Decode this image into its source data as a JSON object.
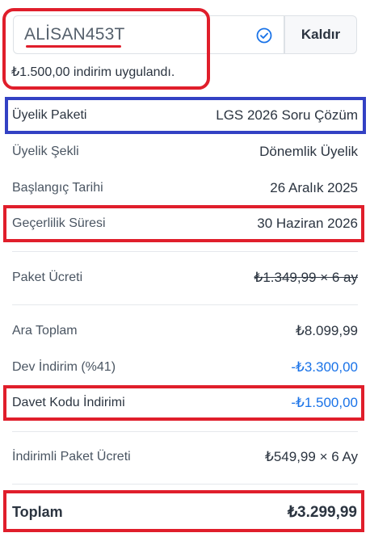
{
  "coupon": {
    "code": "ALİSAN453T",
    "remove_label": "Kaldır",
    "applied_message": "₺1.500,00 indirim uygulandı."
  },
  "rows": {
    "package": {
      "label": "Üyelik Paketi",
      "value": "LGS 2026 Soru Çözüm"
    },
    "type": {
      "label": "Üyelik Şekli",
      "value": "Dönemlik Üyelik"
    },
    "start": {
      "label": "Başlangıç Tarihi",
      "value": "26 Aralık 2025"
    },
    "validity": {
      "label": "Geçerlilik Süresi",
      "value": "30 Haziran 2026"
    },
    "package_fee": {
      "label": "Paket Ücreti",
      "value": "₺1.349,99 × 6 ay"
    },
    "subtotal": {
      "label": "Ara Toplam",
      "value": "₺8.099,99"
    },
    "big_discount": {
      "label": "Dev İndirim (%41)",
      "value": "-₺3.300,00"
    },
    "invite_discount": {
      "label": "Davet Kodu İndirimi",
      "value": "-₺1.500,00"
    },
    "discounted_fee": {
      "label": "İndirimli Paket Ücreti",
      "value": "₺549,99 × 6 Ay"
    }
  },
  "total": {
    "label": "Toplam",
    "value": "₺3.299,99"
  },
  "colors": {
    "highlight_red": "#e01e2b",
    "highlight_blue": "#3341c4",
    "discount_blue": "#1a73e8",
    "success_icon": "#1a73e8"
  },
  "icons": {
    "applied": "check-circle-icon"
  }
}
